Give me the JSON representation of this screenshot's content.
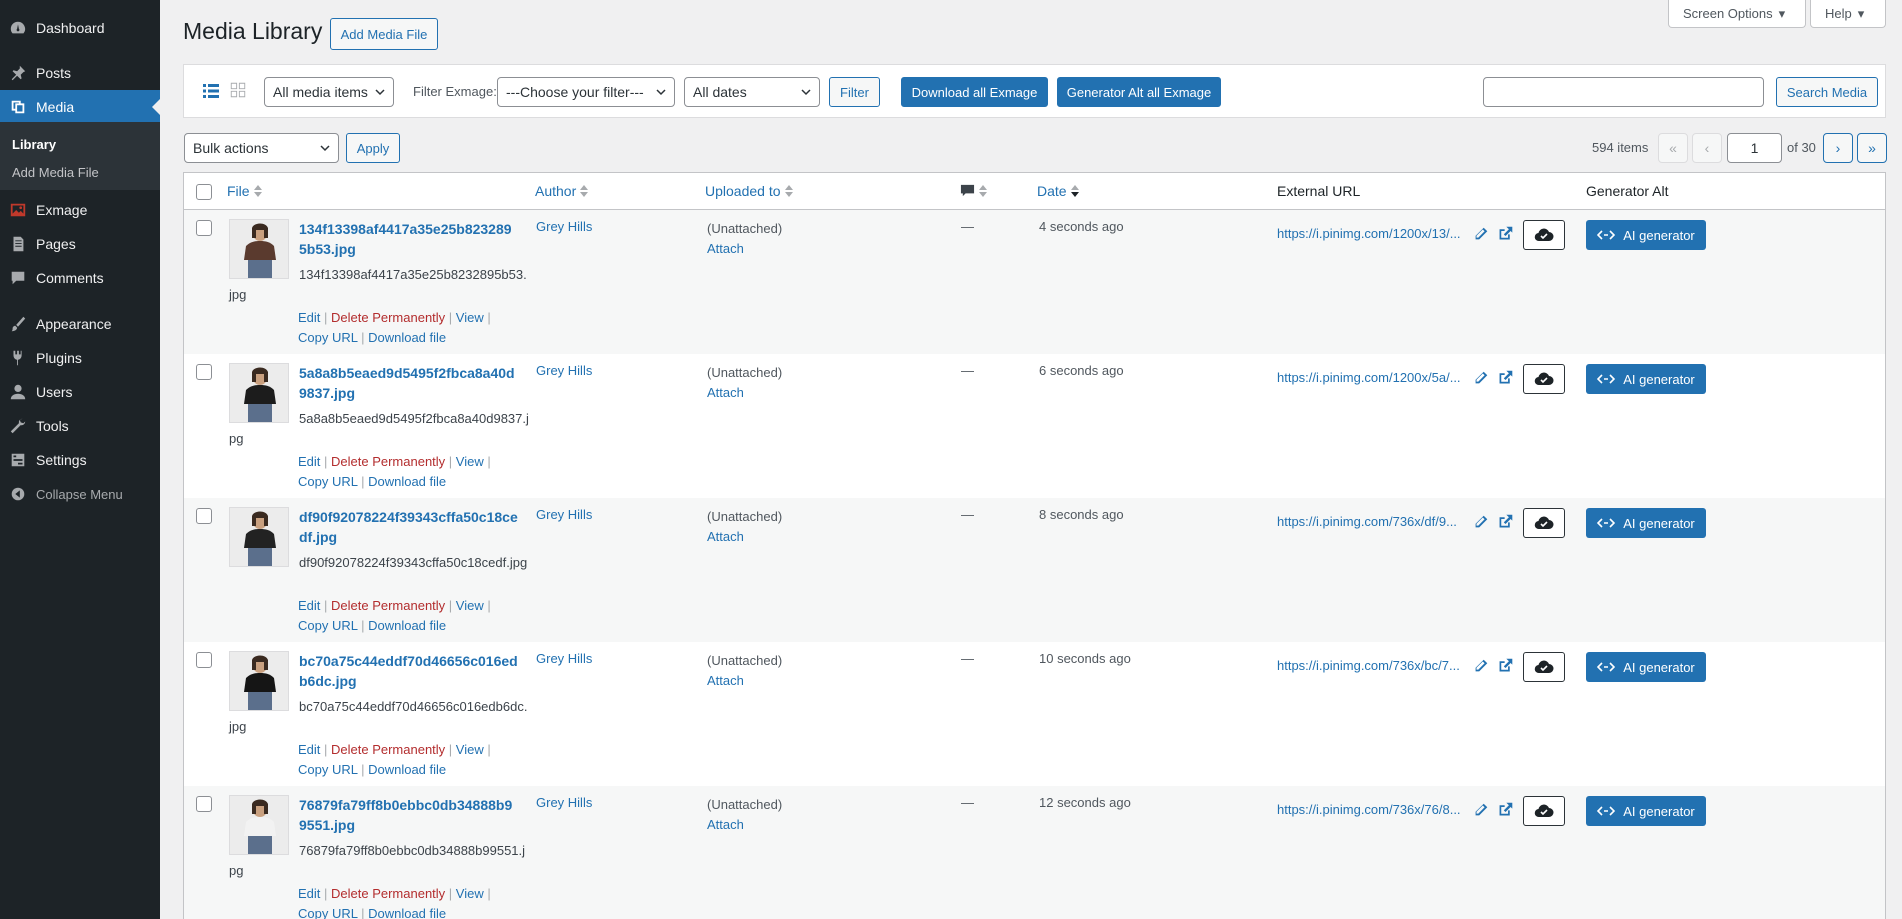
{
  "sidebar": {
    "items": [
      {
        "label": "Dashboard",
        "icon": "dashboard-icon"
      },
      {
        "label": "Posts",
        "icon": "pin-icon"
      },
      {
        "label": "Media",
        "icon": "media-icon"
      },
      {
        "label": "Exmage",
        "icon": "image-icon"
      },
      {
        "label": "Pages",
        "icon": "page-icon"
      },
      {
        "label": "Comments",
        "icon": "comment-icon"
      },
      {
        "label": "Appearance",
        "icon": "brush-icon"
      },
      {
        "label": "Plugins",
        "icon": "plug-icon"
      },
      {
        "label": "Users",
        "icon": "user-icon"
      },
      {
        "label": "Tools",
        "icon": "wrench-icon"
      },
      {
        "label": "Settings",
        "icon": "settings-icon"
      }
    ],
    "submenu": [
      "Library",
      "Add Media File"
    ],
    "collapse": "Collapse Menu",
    "accent": "#2271b1"
  },
  "top": {
    "screen_options": "Screen Options",
    "help": "Help"
  },
  "header": {
    "title": "Media Library",
    "add_button": "Add Media File"
  },
  "filters": {
    "media_type": "All media items",
    "exmage_label": "Filter Exmage:",
    "exmage_select": "---Choose your filter---",
    "dates": "All dates",
    "filter_button": "Filter",
    "download_all": "Download all Exmage",
    "generator_all": "Generator Alt all Exmage",
    "search_value": "",
    "search_button": "Search Media"
  },
  "bulk": {
    "select": "Bulk actions",
    "apply": "Apply"
  },
  "pagination": {
    "count": "594 items",
    "first": "«",
    "prev": "‹",
    "current": "1",
    "of": "of 30",
    "next": "›",
    "last": "»"
  },
  "table": {
    "headers": {
      "file": "File",
      "author": "Author",
      "uploaded": "Uploaded to",
      "date": "Date",
      "external": "External URL",
      "generator": "Generator Alt"
    },
    "rows": [
      {
        "title": "134f13398af4417a35e25b8232895b53.jpg",
        "filename": "134f13398af4417a35e25b8232895b53.jpg",
        "author": "Grey Hills",
        "uploaded": "(Unattached)",
        "attach": "Attach",
        "comments": "—",
        "date": "4 seconds ago",
        "url": "https://i.pinimg.com/1200x/13/...",
        "ai": "AI generator",
        "shirt": "#5a3a2e"
      },
      {
        "title": "5a8a8b5eaed9d5495f2fbca8a40d9837.jpg",
        "filename": "5a8a8b5eaed9d5495f2fbca8a40d9837.jpg",
        "author": "Grey Hills",
        "uploaded": "(Unattached)",
        "attach": "Attach",
        "comments": "—",
        "date": "6 seconds ago",
        "url": "https://i.pinimg.com/1200x/5a/...",
        "ai": "AI generator",
        "shirt": "#1c1c1c"
      },
      {
        "title": "df90f92078224f39343cffa50c18cedf.jpg",
        "filename": "df90f92078224f39343cffa50c18cedf.jpg",
        "author": "Grey Hills",
        "uploaded": "(Unattached)",
        "attach": "Attach",
        "comments": "—",
        "date": "8 seconds ago",
        "url": "https://i.pinimg.com/736x/df/9...",
        "ai": "AI generator",
        "shirt": "#222222"
      },
      {
        "title": "bc70a75c44eddf70d46656c016edb6dc.jpg",
        "filename": "bc70a75c44eddf70d46656c016edb6dc.jpg",
        "author": "Grey Hills",
        "uploaded": "(Unattached)",
        "attach": "Attach",
        "comments": "—",
        "date": "10 seconds ago",
        "url": "https://i.pinimg.com/736x/bc/7...",
        "ai": "AI generator",
        "shirt": "#151515"
      },
      {
        "title": "76879fa79ff8b0ebbc0db34888b99551.jpg",
        "filename": "76879fa79ff8b0ebbc0db34888b99551.jpg",
        "author": "Grey Hills",
        "uploaded": "(Unattached)",
        "attach": "Attach",
        "comments": "—",
        "date": "12 seconds ago",
        "url": "https://i.pinimg.com/736x/76/8...",
        "ai": "AI generator",
        "shirt": "#f2f2f2"
      }
    ],
    "row_actions": {
      "edit": "Edit",
      "delete": "Delete Permanently",
      "view": "View",
      "copy": "Copy URL",
      "download": "Download file"
    }
  }
}
